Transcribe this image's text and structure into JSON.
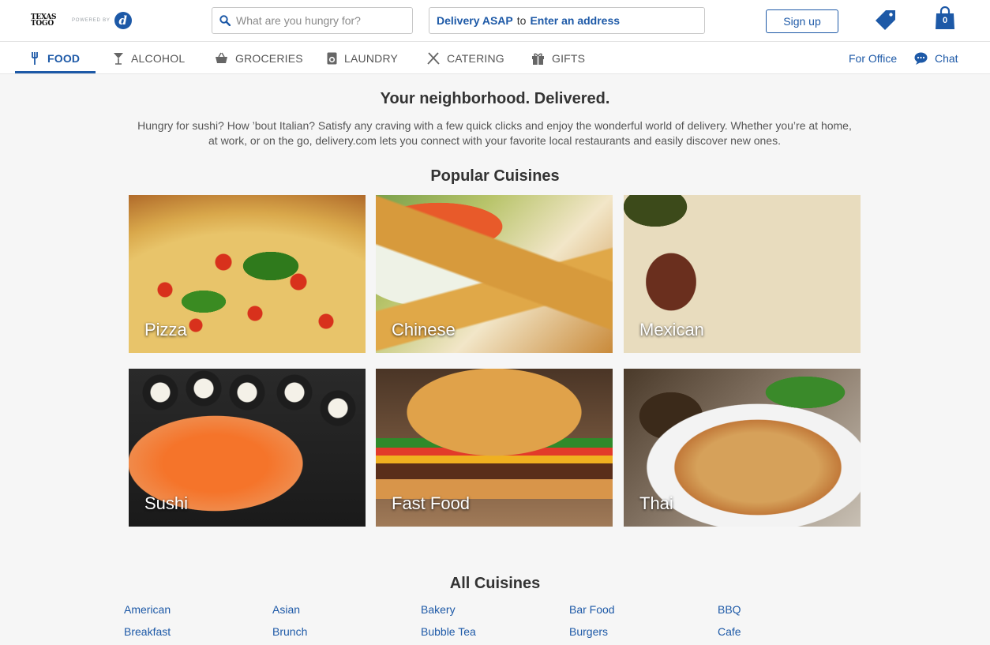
{
  "header": {
    "logo_text_line1": "TEXAS",
    "logo_text_line2": "TOGO",
    "logo_powered": "POWERED BY",
    "logo_letter": "d",
    "search_placeholder": "What are you hungry for?",
    "delivery_asap": "Delivery ASAP",
    "delivery_to": "to",
    "delivery_address": "Enter an address",
    "signup_label": "Sign up",
    "cart_count": "0"
  },
  "nav": {
    "items": [
      {
        "label": "FOOD",
        "icon": "fork-icon",
        "active": true
      },
      {
        "label": "ALCOHOL",
        "icon": "cocktail-icon"
      },
      {
        "label": "GROCERIES",
        "icon": "basket-icon"
      },
      {
        "label": "LAUNDRY",
        "icon": "washer-icon"
      },
      {
        "label": "CATERING",
        "icon": "utensils-icon"
      },
      {
        "label": "GIFTS",
        "icon": "gift-icon"
      }
    ],
    "for_office": "For Office",
    "chat": "Chat"
  },
  "hero": {
    "title": "Your neighborhood. Delivered.",
    "text": "Hungry for sushi? How ’bout Italian? Satisfy any craving with a few quick clicks and enjoy the wonderful world of delivery. Whether you’re at home, at work, or on the go, delivery.com lets you connect with your favorite local restaurants and easily discover new ones."
  },
  "popular": {
    "title": "Popular Cuisines",
    "tiles": [
      "Pizza",
      "Chinese",
      "Mexican",
      "Sushi",
      "Fast Food",
      "Thai"
    ]
  },
  "all_cuisines": {
    "title": "All Cuisines",
    "items": [
      "American",
      "Asian",
      "Bakery",
      "Bar Food",
      "BBQ",
      "Breakfast",
      "Brunch",
      "Bubble Tea",
      "Burgers",
      "Cafe"
    ]
  },
  "colors": {
    "accent": "#1d59a7",
    "background": "#f6f6f6"
  }
}
